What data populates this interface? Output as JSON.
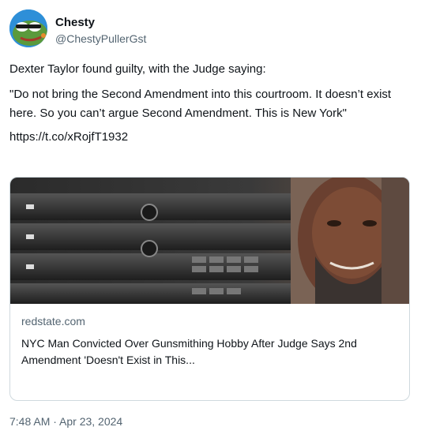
{
  "author": {
    "display_name": "Chesty",
    "handle": "@ChestyPullerGst",
    "avatar_icon": "frog-avatar-icon"
  },
  "tweet": {
    "line1": "Dexter Taylor found guilty, with the Judge saying:",
    "quote": "\"Do not bring the Second Amendment into this courtroom. It doesn’t exist here. So you can’t argue Second Amendment. This is New York\"",
    "link": "https://t.co/xRojfT1932"
  },
  "card": {
    "domain": "redstate.com",
    "title": "NYC Man Convicted Over Gunsmithing Hobby After Judge Says 2nd Amendment 'Doesn't Exist in This..."
  },
  "meta": {
    "timestamp": "7:48 AM · Apr 23, 2024"
  },
  "colors": {
    "text_primary": "#0f1419",
    "text_secondary": "#536471",
    "card_border": "#cfd9de"
  }
}
